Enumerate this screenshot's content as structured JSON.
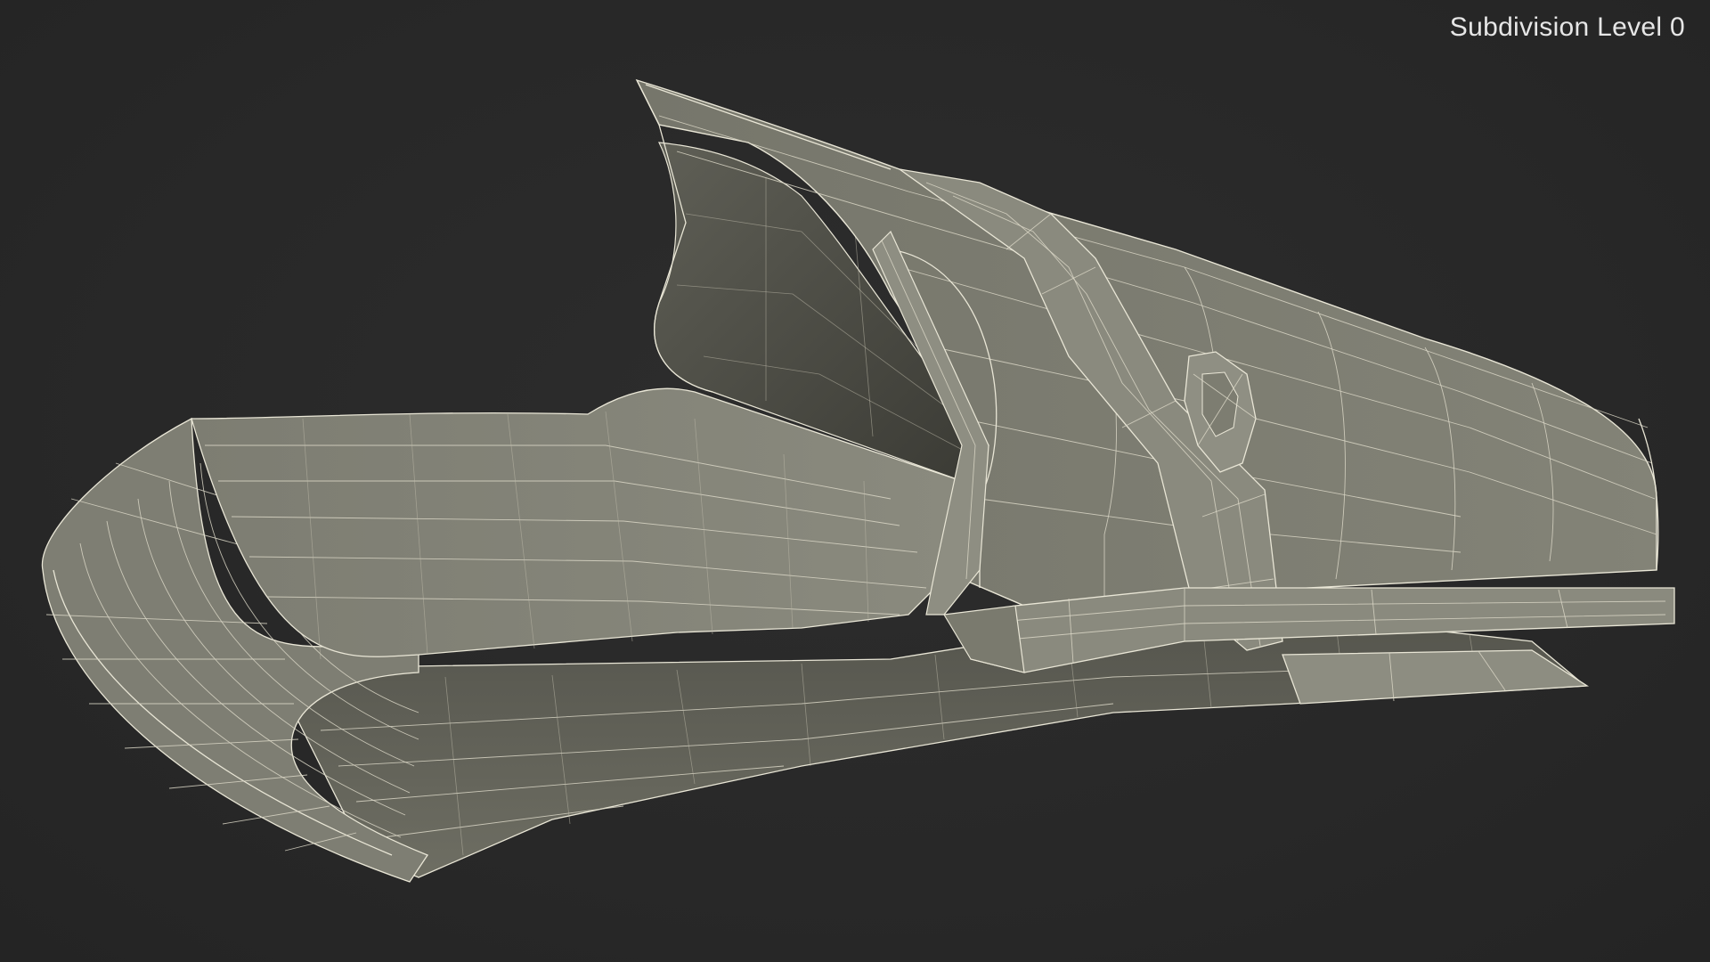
{
  "viewport": {
    "label": "Subdivision Level 0",
    "background_color": "#2a2a2a",
    "mesh_fill_color": "#7b7b70",
    "wire_color": "#e9e6d6"
  },
  "scene": {
    "object": "holster-mesh-wireframe"
  }
}
